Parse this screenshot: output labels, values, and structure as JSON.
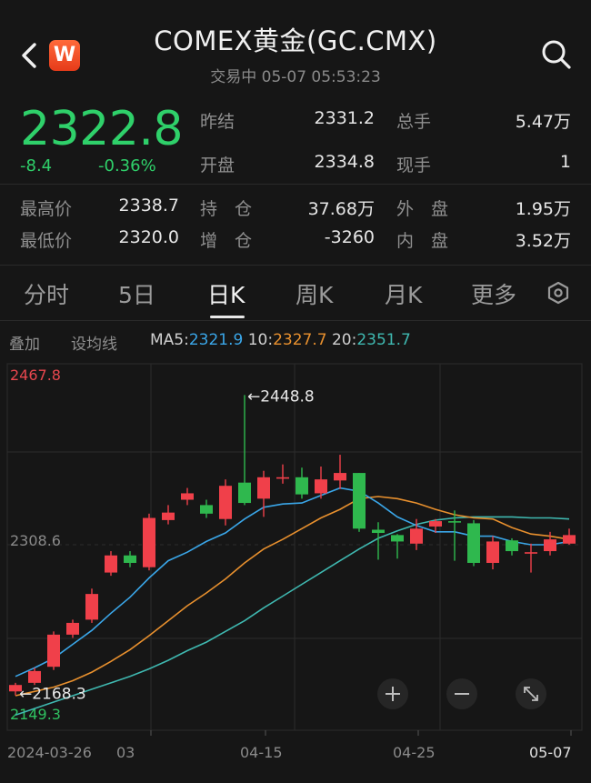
{
  "header": {
    "title": "COMEX黄金(GC.CMX)",
    "subtitle": "交易中 05-07 05:53:23",
    "logo_letter": "W",
    "back_icon": "chevron-left-icon",
    "search_icon": "search-icon"
  },
  "quote": {
    "price": "2322.8",
    "change": "-8.4",
    "change_pct": "-0.36%",
    "color_down": "#2fd06a",
    "color_up": "#ff4040",
    "fields": {
      "prev_settle_label": "昨结",
      "prev_settle_value": "2331.2",
      "total_vol_label": "总手",
      "total_vol_value": "5.47万",
      "open_label": "开盘",
      "open_value": "2334.8",
      "cur_vol_label": "现手",
      "cur_vol_value": "1",
      "high_label": "最高价",
      "high_value": "2338.7",
      "oi_label": "持　仓",
      "oi_value": "37.68万",
      "outer_label": "外　盘",
      "outer_value": "1.95万",
      "low_label": "最低价",
      "low_value": "2320.0",
      "oi_chg_label": "增　仓",
      "oi_chg_value": "-3260",
      "inner_label": "内　盘",
      "inner_value": "3.52万"
    }
  },
  "tabs": [
    "分时",
    "5日",
    "日K",
    "周K",
    "月K",
    "更多"
  ],
  "active_tab": "日K",
  "indicators": {
    "overlay_label": "叠加",
    "ma_setting_label": "设均线",
    "ma5_label": "MA5:",
    "ma5_value": "2321.9",
    "ma10_label": "10:",
    "ma10_value": "2327.7",
    "ma20_label": "20:",
    "ma20_value": "2351.7",
    "ma5_color": "#3aa6e8",
    "ma10_color": "#e8902e",
    "ma20_color": "#3fb8b0"
  },
  "chart_data": {
    "type": "candlestick",
    "y_top_label": "2467.8",
    "y_mid_label": "2308.6",
    "y_bottom_label": "2149.3",
    "ylim": [
      2149.3,
      2467.8
    ],
    "max_annotation": "←2448.8",
    "min_annotation": "←2168.3",
    "x_tick_labels": [
      "2024-03-26",
      "03",
      "04-15",
      "04-25",
      "05-07"
    ],
    "up_color": "#f0404a",
    "down_color": "#2fb84e",
    "candles": [
      {
        "o": 2172,
        "c": 2178,
        "h": 2180,
        "l": 2168.3
      },
      {
        "o": 2180,
        "c": 2191,
        "h": 2194,
        "l": 2178
      },
      {
        "o": 2195,
        "c": 2225,
        "h": 2228,
        "l": 2192
      },
      {
        "o": 2225,
        "c": 2236,
        "h": 2239,
        "l": 2222
      },
      {
        "o": 2239,
        "c": 2263,
        "h": 2268,
        "l": 2236
      },
      {
        "o": 2283,
        "c": 2299,
        "h": 2303,
        "l": 2280
      },
      {
        "o": 2299,
        "c": 2292,
        "h": 2303,
        "l": 2288
      },
      {
        "o": 2288,
        "c": 2334,
        "h": 2338,
        "l": 2285
      },
      {
        "o": 2332,
        "c": 2339,
        "h": 2346,
        "l": 2328
      },
      {
        "o": 2351,
        "c": 2357,
        "h": 2362,
        "l": 2346
      },
      {
        "o": 2346,
        "c": 2338,
        "h": 2351,
        "l": 2334
      },
      {
        "o": 2333,
        "c": 2364,
        "h": 2370,
        "l": 2327
      },
      {
        "o": 2367,
        "c": 2348,
        "h": 2448.8,
        "l": 2346
      },
      {
        "o": 2352,
        "c": 2372,
        "h": 2378,
        "l": 2335
      },
      {
        "o": 2372,
        "c": 2372,
        "h": 2384,
        "l": 2366
      },
      {
        "o": 2372,
        "c": 2356,
        "h": 2381,
        "l": 2352
      },
      {
        "o": 2357,
        "c": 2370,
        "h": 2382,
        "l": 2352
      },
      {
        "o": 2369,
        "c": 2376,
        "h": 2393,
        "l": 2361
      },
      {
        "o": 2376,
        "c": 2324,
        "h": 2376,
        "l": 2321
      },
      {
        "o": 2323,
        "c": 2320,
        "h": 2330,
        "l": 2295
      },
      {
        "o": 2318,
        "c": 2312,
        "h": 2319,
        "l": 2296
      },
      {
        "o": 2310,
        "c": 2324,
        "h": 2333,
        "l": 2304
      },
      {
        "o": 2326,
        "c": 2331,
        "h": 2333,
        "l": 2320
      },
      {
        "o": 2331,
        "c": 2330,
        "h": 2341,
        "l": 2294
      },
      {
        "o": 2329,
        "c": 2292,
        "h": 2332,
        "l": 2289
      },
      {
        "o": 2292,
        "c": 2312,
        "h": 2317,
        "l": 2286
      },
      {
        "o": 2313,
        "c": 2303,
        "h": 2315,
        "l": 2299
      },
      {
        "o": 2302,
        "c": 2302,
        "h": 2310,
        "l": 2283
      },
      {
        "o": 2303,
        "c": 2314,
        "h": 2321,
        "l": 2299
      },
      {
        "o": 2310,
        "c": 2318,
        "h": 2324,
        "l": 2309
      }
    ],
    "ma5": [
      2186,
      2194,
      2203,
      2216,
      2229,
      2245,
      2260,
      2278,
      2294,
      2302,
      2312,
      2320,
      2333,
      2344,
      2347,
      2348,
      2355,
      2362,
      2359,
      2348,
      2335,
      2327,
      2321,
      2321,
      2317,
      2317,
      2312,
      2309,
      2309,
      2312
    ],
    "ma10": [
      2168,
      2172,
      2176,
      2182,
      2190,
      2200,
      2211,
      2224,
      2238,
      2252,
      2264,
      2277,
      2292,
      2305,
      2314,
      2324,
      2334,
      2342,
      2352,
      2354,
      2352,
      2348,
      2342,
      2337,
      2334,
      2333,
      2325,
      2319,
      2317,
      2314
    ],
    "ma20": [
      2150,
      2156,
      2162,
      2168,
      2174,
      2180,
      2186,
      2193,
      2201,
      2210,
      2218,
      2228,
      2238,
      2250,
      2261,
      2272,
      2283,
      2294,
      2305,
      2315,
      2322,
      2328,
      2332,
      2334,
      2335,
      2335,
      2335,
      2334,
      2334,
      2333
    ]
  },
  "chart_controls": {
    "zoom_in_icon": "plus-icon",
    "zoom_out_icon": "minus-icon",
    "fullscreen_icon": "expand-icon"
  }
}
